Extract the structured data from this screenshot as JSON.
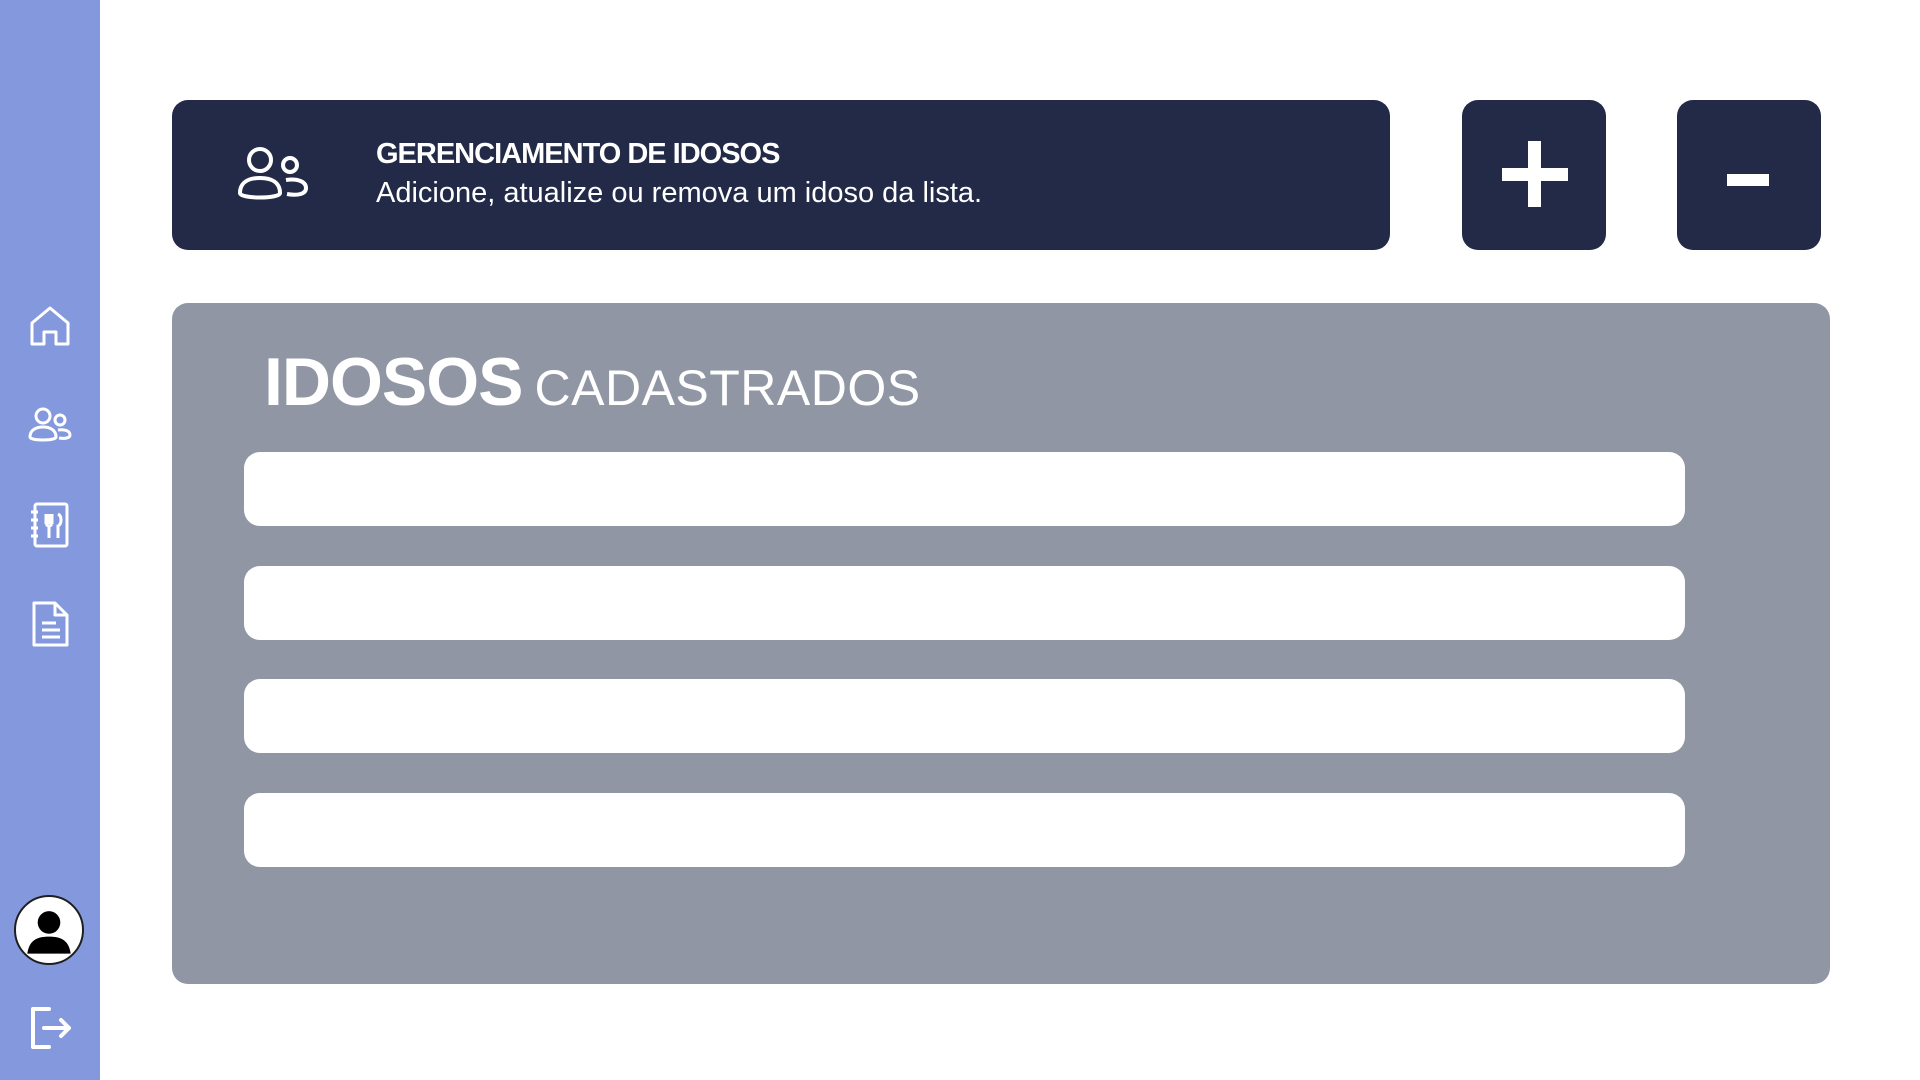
{
  "sidebar": {
    "items": [
      {
        "icon": "home-icon"
      },
      {
        "icon": "users-icon"
      },
      {
        "icon": "menu-book-icon"
      },
      {
        "icon": "document-icon"
      }
    ],
    "avatar_icon": "user-avatar-icon",
    "logout_icon": "logout-icon"
  },
  "header": {
    "icon": "users-icon",
    "title": "GERENCIAMENTO DE IDOSOS",
    "subtitle": "Adicione, atualize ou remova um idoso da lista."
  },
  "actions": {
    "add_icon": "plus-icon",
    "remove_icon": "minus-icon"
  },
  "list": {
    "title_bold": "IDOSOS",
    "title_light": "CADASTRADOS",
    "rows": [
      "",
      "",
      "",
      ""
    ]
  },
  "colors": {
    "sidebar": "#8499dd",
    "dark_navy": "#222a48",
    "panel_gray": "#9096a3",
    "white": "#ffffff"
  }
}
